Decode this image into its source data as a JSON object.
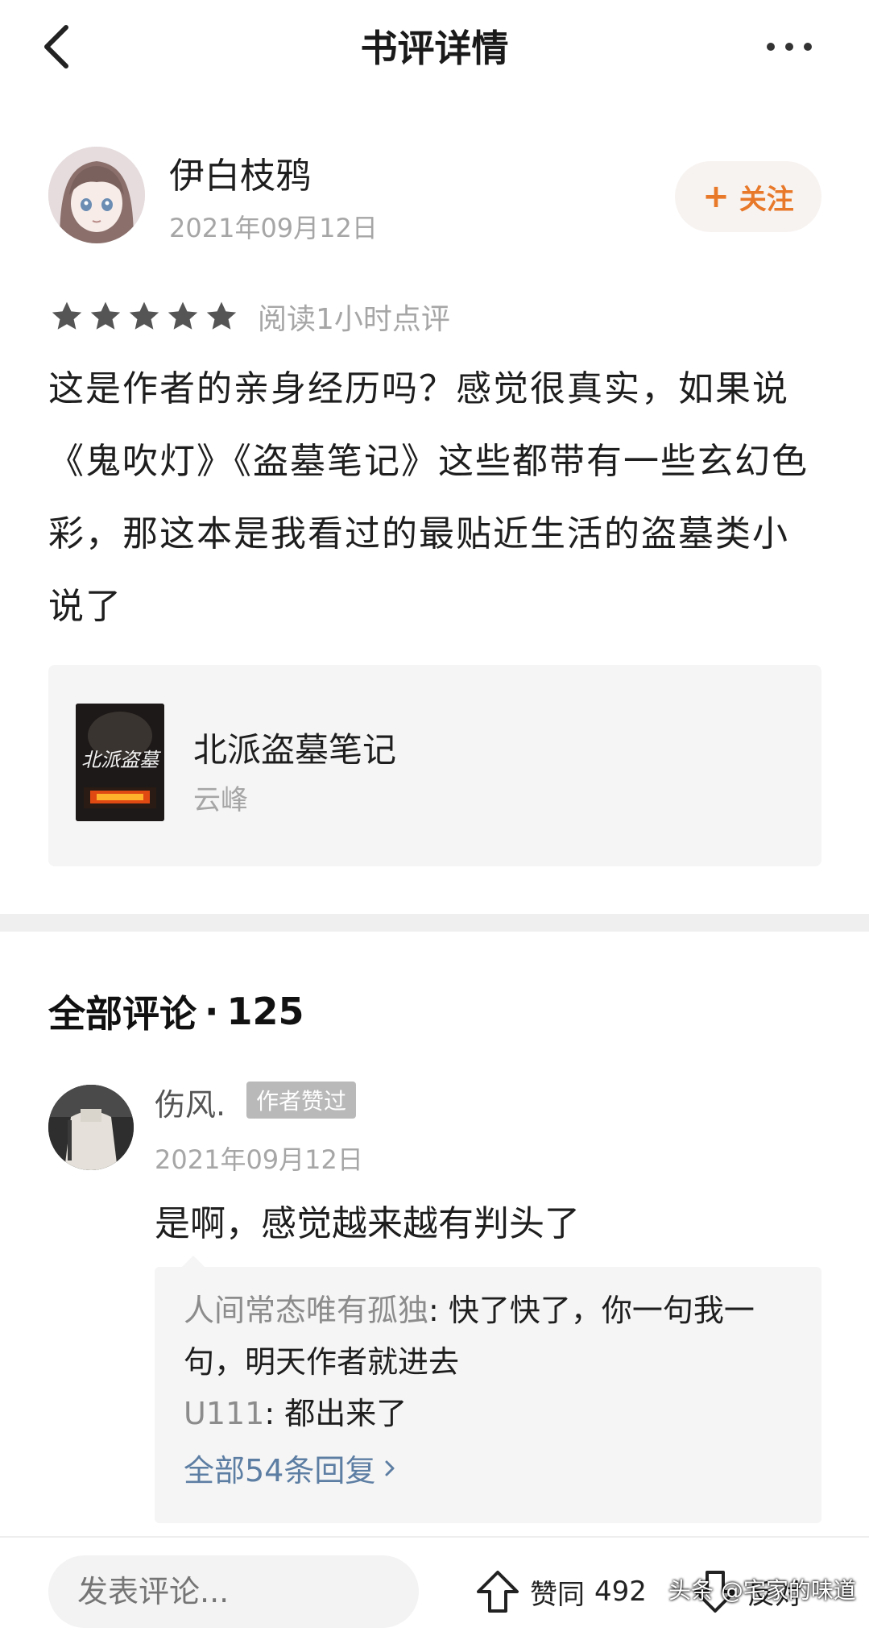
{
  "header": {
    "title": "书评详情"
  },
  "reviewer": {
    "name": "伊白枝鸦",
    "date": "2021年09月12日",
    "follow_label": "关注"
  },
  "rating": {
    "stars": 5,
    "max_stars": 5,
    "note": "阅读1小时点评"
  },
  "review": {
    "text": "这是作者的亲身经历吗？感觉很真实，如果说《鬼吹灯》《盗墓笔记》这些都带有一些玄幻色彩，那这本是我看过的最贴近生活的盗墓类小说了"
  },
  "book": {
    "title": "北派盗墓笔记",
    "author": "云峰",
    "cover_text": "北派盗墓"
  },
  "comments": {
    "heading": "全部评论",
    "count": "125",
    "items": [
      {
        "name": "伤风.",
        "badge": "作者赞过",
        "date": "2021年09月12日",
        "text": "是啊，感觉越来越有判头了",
        "replies": [
          {
            "user": "人间常态唯有孤独",
            "text": "快了快了，你一句我一句，明天作者就进去"
          },
          {
            "user": "U111",
            "text": "都出来了"
          }
        ],
        "view_all_label": "全部54条回复"
      }
    ]
  },
  "bottom_bar": {
    "input_placeholder": "发表评论...",
    "like_label": "赞同",
    "like_count": "492",
    "dislike_label": "反对"
  },
  "watermark": {
    "text": "头条 @宅家的味道"
  },
  "colors": {
    "accent": "#e8792a",
    "link": "#5d7ea3",
    "muted": "#a6a6a6"
  }
}
